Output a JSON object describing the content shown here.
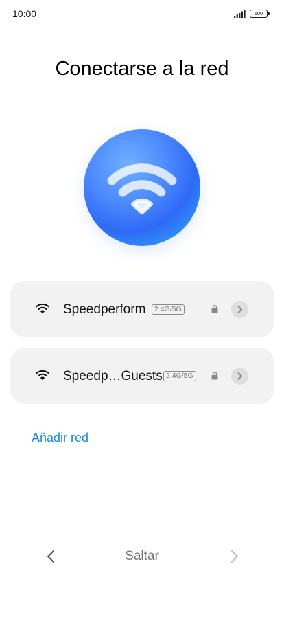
{
  "status_bar": {
    "time": "10:00",
    "battery": "100",
    "icons": [
      "signal-icon",
      "battery-icon"
    ]
  },
  "page": {
    "title": "Conectarse a la red"
  },
  "hero": {
    "icon": "wifi-icon",
    "colors": {
      "light": "#6fb0ff",
      "mid": "#2f6af5",
      "edge": "#49c6ff"
    }
  },
  "networks": [
    {
      "name": "Speedperform",
      "band": "2.4G/5G",
      "icons": [
        "wifi-icon",
        "lock-icon",
        "chevron-right-icon"
      ]
    },
    {
      "name": "Speedp…Guests",
      "band": "2.4G/5G",
      "icons": [
        "wifi-icon",
        "lock-icon",
        "chevron-right-icon"
      ]
    }
  ],
  "add_network": {
    "label": "Añadir red"
  },
  "bottom_nav": {
    "skip_label": "Saltar",
    "icons": [
      "chevron-left-icon",
      "chevron-right-icon"
    ]
  },
  "colors": {
    "accent": "#1a88d8",
    "card": "#f2f2f2",
    "muted_text": "#777777"
  }
}
